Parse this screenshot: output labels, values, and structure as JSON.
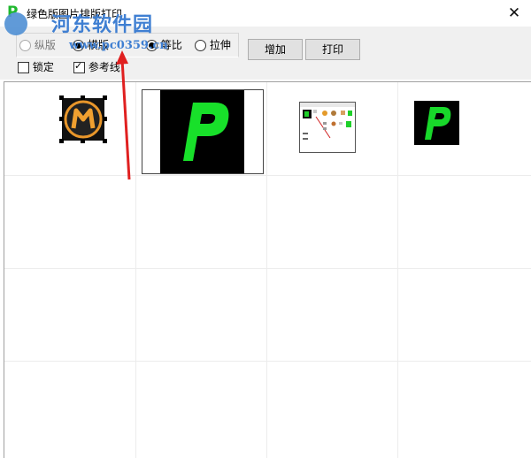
{
  "window": {
    "title": "绿色版图片排版打印",
    "app_icon_letter": "P",
    "close_glyph": "✕"
  },
  "watermark": {
    "text": "河东软件园",
    "url": "www.pc0359.cn"
  },
  "toolbar": {
    "orientation": [
      {
        "label": "纵版",
        "selected": false
      },
      {
        "label": "横版",
        "selected": true
      }
    ],
    "scale": [
      {
        "label": "等比",
        "selected": true
      },
      {
        "label": "拉伸",
        "selected": false
      }
    ],
    "lock_label": "锁定",
    "lock_checked": false,
    "guides_label": "参考线",
    "guides_checked": true,
    "add_label": "增加",
    "print_label": "打印"
  },
  "grid": {
    "columns": 4,
    "rows": 4
  },
  "images": [
    {
      "name": "Maya-style logo",
      "icon": "maya-logo-icon",
      "selected": true
    },
    {
      "name": "Green P large",
      "icon": "green-p-icon"
    },
    {
      "name": "App screenshot",
      "icon": "screenshot-thumbnail"
    },
    {
      "name": "Green P small",
      "icon": "green-p-icon"
    }
  ],
  "colors": {
    "accent_green": "#1fb82e",
    "annotation_red": "#e02020",
    "watermark_blue": "#3f7fd2"
  }
}
